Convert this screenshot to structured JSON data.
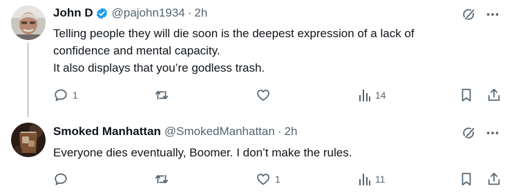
{
  "tweets": [
    {
      "author": {
        "name": "John D",
        "handle": "@pajohn1934",
        "verified": true,
        "avatar_icon": "man-portrait-avatar"
      },
      "time": "2h",
      "lines": [
        "Telling people they will die soon is the deepest expression of a lack of",
        "confidence and mental capacity.",
        "It also displays that you’re godless trash."
      ],
      "actions": {
        "replies": "1",
        "reposts": "",
        "likes": "",
        "views": "14"
      }
    },
    {
      "author": {
        "name": "Smoked Manhattan",
        "handle": "@SmokedManhattan",
        "verified": false,
        "avatar_icon": "cocktail-glass-avatar"
      },
      "time": "2h",
      "lines": [
        "Everyone dies eventually, Boomer. I don’t make the rules."
      ],
      "actions": {
        "replies": "",
        "reposts": "",
        "likes": "1",
        "views": "11"
      }
    }
  ],
  "separator": "·",
  "colors": {
    "text": "#0f1419",
    "secondary": "#536471",
    "verified": "#1d9bf0",
    "thread_line": "#cfd9de"
  }
}
